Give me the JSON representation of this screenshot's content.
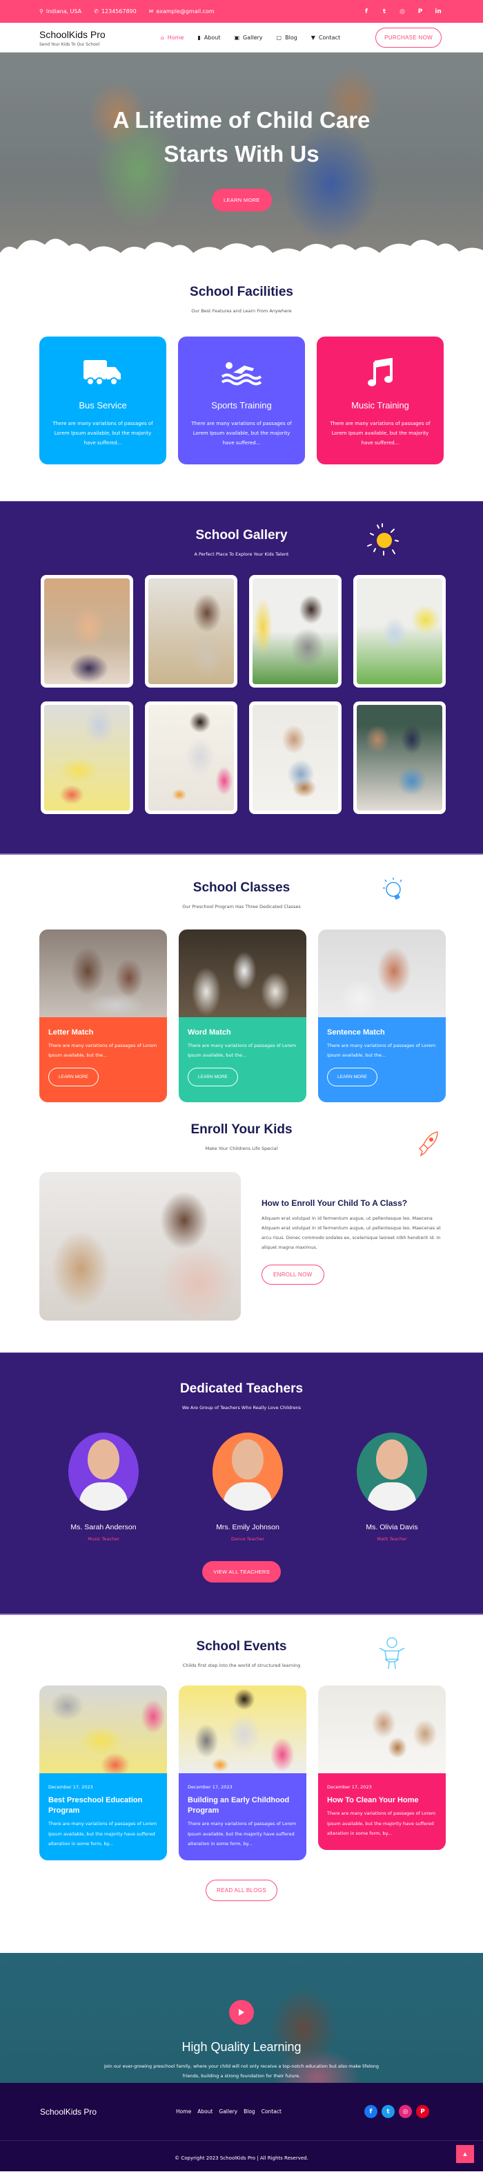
{
  "topbar": {
    "location": "Indiana, USA",
    "phone": "1234567890",
    "email": "example@gmail.com",
    "social": [
      "facebook",
      "twitter",
      "instagram",
      "pinterest",
      "linkedin"
    ]
  },
  "nav": {
    "brand_title": "SchoolKids Pro",
    "brand_tagline": "Send Your Kids To Our School",
    "items": [
      {
        "label": "Home",
        "icon": "home-icon",
        "active": true
      },
      {
        "label": "About",
        "icon": "book-icon"
      },
      {
        "label": "Gallery",
        "icon": "image-icon"
      },
      {
        "label": "Blog",
        "icon": "blog-icon"
      },
      {
        "label": "Contact",
        "icon": "chat-icon"
      }
    ],
    "cta": "PURCHASE NOW"
  },
  "hero": {
    "title": "A Lifetime of Child Care Starts With Us",
    "button": "LEARN MORE"
  },
  "facilities": {
    "title": "School Facilities",
    "subtitle": "Our Best Features and Learn From Anywhere",
    "cards": [
      {
        "title": "Bus Service",
        "icon": "truck-icon",
        "text": "There are many variations of passages of Lorem Ipsum available, but the majority have suffered...",
        "color": "#00aeff"
      },
      {
        "title": "Sports Training",
        "icon": "swimmer-icon",
        "text": "There are many variations of passages of Lorem Ipsum available, but the majority have suffered...",
        "color": "#645aff"
      },
      {
        "title": "Music Training",
        "icon": "music-note-icon",
        "text": "There are many variations of passages of Lorem Ipsum available, but the majority have suffered...",
        "color": "#f8206e"
      }
    ]
  },
  "gallery": {
    "title": "School Gallery",
    "subtitle": "A Perfect Place To Explore Your Kids Talent",
    "background": "#351c75",
    "images": [
      {
        "alt": "Smiling girl with hands on chin"
      },
      {
        "alt": "Girl playing with toy at desk"
      },
      {
        "alt": "Children playing with toys"
      },
      {
        "alt": "Girl playing with blocks on floor"
      },
      {
        "alt": "Hands cutting colorful paper"
      },
      {
        "alt": "Teacher drawing with children"
      },
      {
        "alt": "Children reading a book"
      },
      {
        "alt": "Teacher with children and globe"
      }
    ]
  },
  "classes": {
    "title": "School Classes",
    "subtitle": "Our Preschool Program Has Three Dedicated Classes",
    "cards": [
      {
        "title": "Letter Match",
        "text": "There are many variations of passages of Lorem Ipsum available, but the...",
        "button": "LEARN MORE",
        "color": "#ff5a35"
      },
      {
        "title": "Word Match",
        "text": "There are many variations of passages of Lorem Ipsum available, but the...",
        "button": "LEARN MORE",
        "color": "#2ec9a2"
      },
      {
        "title": "Sentence Match",
        "text": "There are many variations of passages of Lorem Ipsum available, but the...",
        "button": "LEARN MORE",
        "color": "#3399ff"
      }
    ]
  },
  "enroll": {
    "title": "Enroll Your Kids",
    "subtitle": "Make Your Childrens Life Special",
    "heading": "How to Enroll Your Child To A Class?",
    "text": "Aliquam erat volutpat In id fermentum augue, ut pellentesque leo. Maecena Aliquam erat volutpat In id fermentum augue, ut pellentesque leo. Maecenas at arcu risus. Donec commodo sodales ex, scelerisque laoreet nibh hendrerit id. In aliquet magna maximus.",
    "button": "ENROLL NOW"
  },
  "teachers": {
    "title": "Dedicated Teachers",
    "subtitle": "We Are Group of Teachers Who Really Love Childrens",
    "list": [
      {
        "name": "Ms. Sarah Anderson",
        "role": "Music Teacher",
        "bg": "#7b3fe4"
      },
      {
        "name": "Mrs. Emily Johnson",
        "role": "Dance Teacher",
        "bg": "#ff8348"
      },
      {
        "name": "Ms. Olivia Davis",
        "role": "Math Teacher",
        "bg": "#2a8577"
      }
    ],
    "button": "VIEW ALL TEACHERS"
  },
  "events": {
    "title": "School Events",
    "subtitle": "Childs first step into the world of structured learning",
    "cards": [
      {
        "date": "December 17, 2023",
        "title": "Best Preschool Education Program",
        "text": "There are many variations of passages of Lorem Ipsum available, but the majority have suffered alteration in some form, by...",
        "color": "#00aeff"
      },
      {
        "date": "December 17, 2023",
        "title": "Building an Early Childhood Program",
        "text": "There are many variations of passages of Lorem Ipsum available, but the majority have suffered alteration in some form, by...",
        "color": "#645aff"
      },
      {
        "date": "December 17, 2023",
        "title": "How To Clean Your Home",
        "text": "There are many variations of passages of Lorem Ipsum available, but the majority have suffered alteration in some form, by...",
        "color": "#f8206e"
      }
    ],
    "button": "READ ALL BLOGS"
  },
  "banner": {
    "title": "High Quality Learning",
    "text": "Join our ever-growing preschool family, where your child will not only receive a top-notch education but also make lifelong friends, building a strong foundation for their future."
  },
  "footer": {
    "brand": "SchoolKids Pro",
    "links": [
      "Home",
      "About",
      "Gallery",
      "Blog",
      "Contact"
    ],
    "social": [
      {
        "name": "facebook",
        "glyph": "f",
        "color": "#1877f2"
      },
      {
        "name": "twitter",
        "glyph": "t",
        "color": "#1d9bf0"
      },
      {
        "name": "instagram",
        "glyph": "◎",
        "color": "#e4287c"
      },
      {
        "name": "pinterest",
        "glyph": "P",
        "color": "#e60023"
      }
    ],
    "copyright": "© Copyright 2023 SchoolKids Pro | All Rights Reserved."
  },
  "colors": {
    "accent": "#ff4778",
    "purple_section": "#351c75",
    "footer_bg": "#1d0645",
    "heading": "#1b1b55"
  }
}
